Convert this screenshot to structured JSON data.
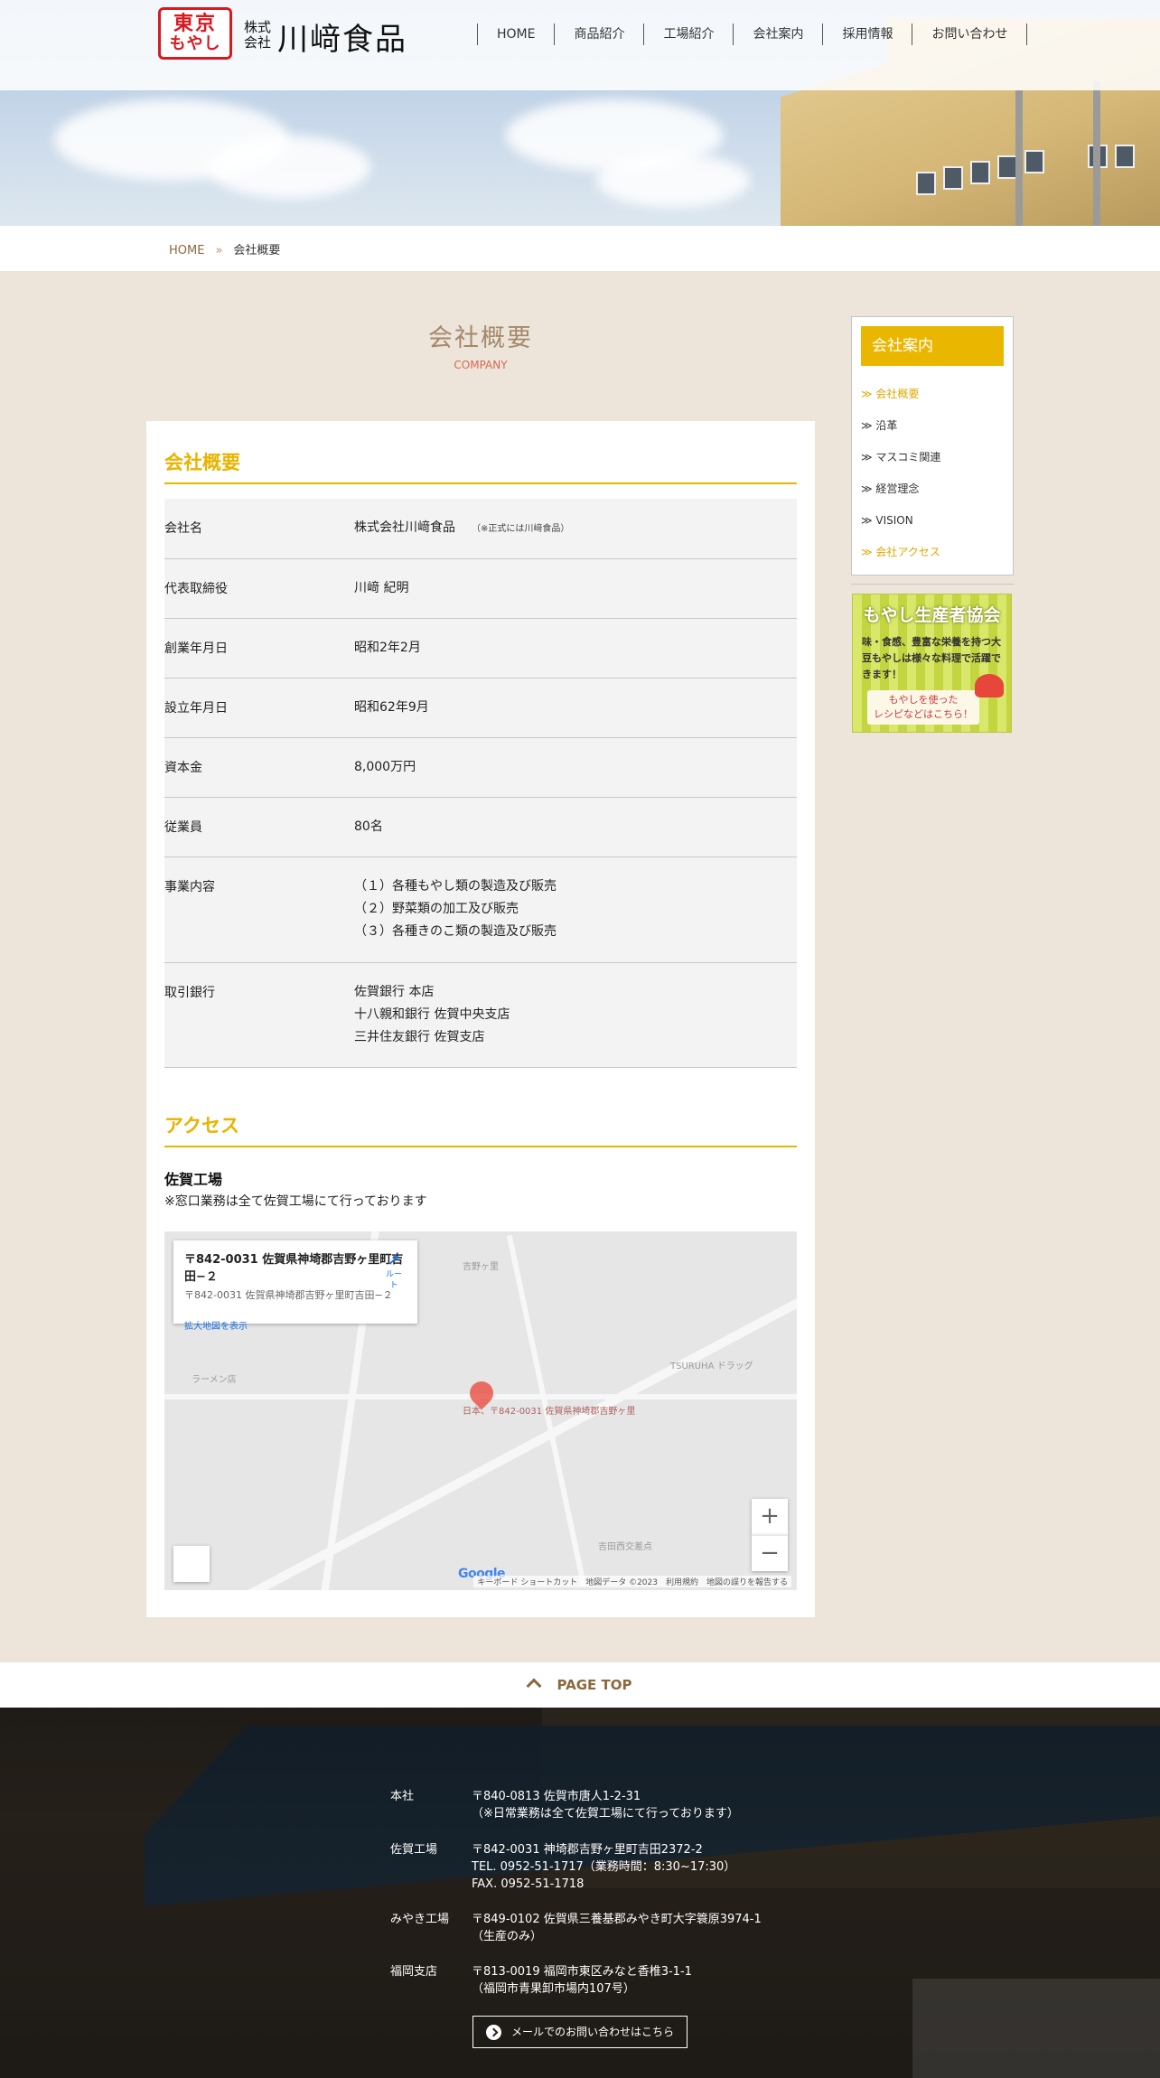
{
  "header": {
    "logo_line1": "東京",
    "logo_line2": "もやし",
    "company_kind": "株式会社",
    "company_name": "川﨑食品",
    "nav": [
      "HOME",
      "商品紹介",
      "工場紹介",
      "会社案内",
      "採用情報",
      "お問い合わせ"
    ]
  },
  "breadcrumb": {
    "home": "HOME",
    "separator": "»",
    "current": "会社概要"
  },
  "page_heading": {
    "jp": "会社概要",
    "en": "COMPANY"
  },
  "overview": {
    "title": "会社概要",
    "rows": [
      {
        "label": "会社名",
        "lines": [
          "株式会社川﨑食品"
        ],
        "note": "（※正式には川﨑食品）"
      },
      {
        "label": "代表取締役",
        "lines": [
          "川﨑 紀明"
        ]
      },
      {
        "label": "創業年月日",
        "lines": [
          "昭和2年2月"
        ]
      },
      {
        "label": "設立年月日",
        "lines": [
          "昭和62年9月"
        ]
      },
      {
        "label": "資本金",
        "lines": [
          "8,000万円"
        ]
      },
      {
        "label": "従業員",
        "lines": [
          "80名"
        ]
      },
      {
        "label": "事業内容",
        "lines": [
          "（１）各種もやし類の製造及び販売",
          "（２）野菜類の加工及び販売",
          "（３）各種きのこ類の製造及び販売"
        ]
      },
      {
        "label": "取引銀行",
        "lines": [
          "佐賀銀行 本店",
          "十八親和銀行 佐賀中央支店",
          "三井住友銀行 佐賀支店"
        ]
      }
    ]
  },
  "access": {
    "title": "アクセス",
    "location_name": "佐賀工場",
    "note": "※窓口業務は全て佐賀工場にて行っております",
    "map": {
      "info_title": "〒842-0031 佐賀県神埼郡吉野ヶ里町吉田−２",
      "info_address": "〒842-0031 佐賀県神埼郡吉野ヶ里町吉田−２",
      "info_link": "拡大地図を表示",
      "directions": "ルート",
      "zoom_in": "+",
      "zoom_out": "−",
      "attribution": "キーボード ショートカット　地図データ ©2023　利用規約　地図の誤りを報告する",
      "watermark": "Google",
      "labels": [
        "吉野ヶ里",
        "日本、〒842-0031 佐賀県神埼郡吉野ヶ里",
        "TSURUHA ドラッグ",
        "吉田西交差点",
        "ラーメン店"
      ]
    }
  },
  "sidebar": {
    "title": "会社案内",
    "items": [
      {
        "label": "≫ 会社概要",
        "active": true
      },
      {
        "label": "≫ 沿革",
        "active": false
      },
      {
        "label": "≫ マスコミ関連",
        "active": false
      },
      {
        "label": "≫ 経営理念",
        "active": false
      },
      {
        "label": "≫ VISION",
        "active": false
      },
      {
        "label": "≫ 会社アクセス",
        "active": true
      }
    ],
    "banner": {
      "title": "もやし生産者協会",
      "text": "味・食感、豊富な栄養を持つ大豆もやしは様々な料理で活躍できます！",
      "button_line1": "もやしを使った",
      "button_line2": "レシピなどはこちら！"
    }
  },
  "pagetop": "PAGE TOP",
  "footer": {
    "offices": [
      {
        "label": "本社",
        "lines": [
          "〒840-0813 佐賀市唐人1-2-31",
          "（※日常業務は全て佐賀工場にて行っております）"
        ]
      },
      {
        "label": "佐賀工場",
        "lines": [
          "〒842-0031 神埼郡吉野ヶ里町吉田2372-2",
          "TEL. 0952-51-1717（業務時間：8:30~17:30）",
          "FAX. 0952-51-1718"
        ]
      },
      {
        "label": "みやき工場",
        "lines": [
          "〒849-0102 佐賀県三養基郡みやき町大字簑原3974-1",
          "（生産のみ）"
        ]
      },
      {
        "label": "福岡支店",
        "lines": [
          "〒813-0019 福岡市東区みなと香椎3-1-1",
          "（福岡市青果卸市場内107号）"
        ]
      }
    ],
    "mail_button": "メールでのお問い合わせはこちら"
  },
  "colors": {
    "accent_yellow": "#e8b400",
    "brand_red": "#d71920",
    "page_background": "#ede4da",
    "link_brown": "#8a6a3e"
  }
}
